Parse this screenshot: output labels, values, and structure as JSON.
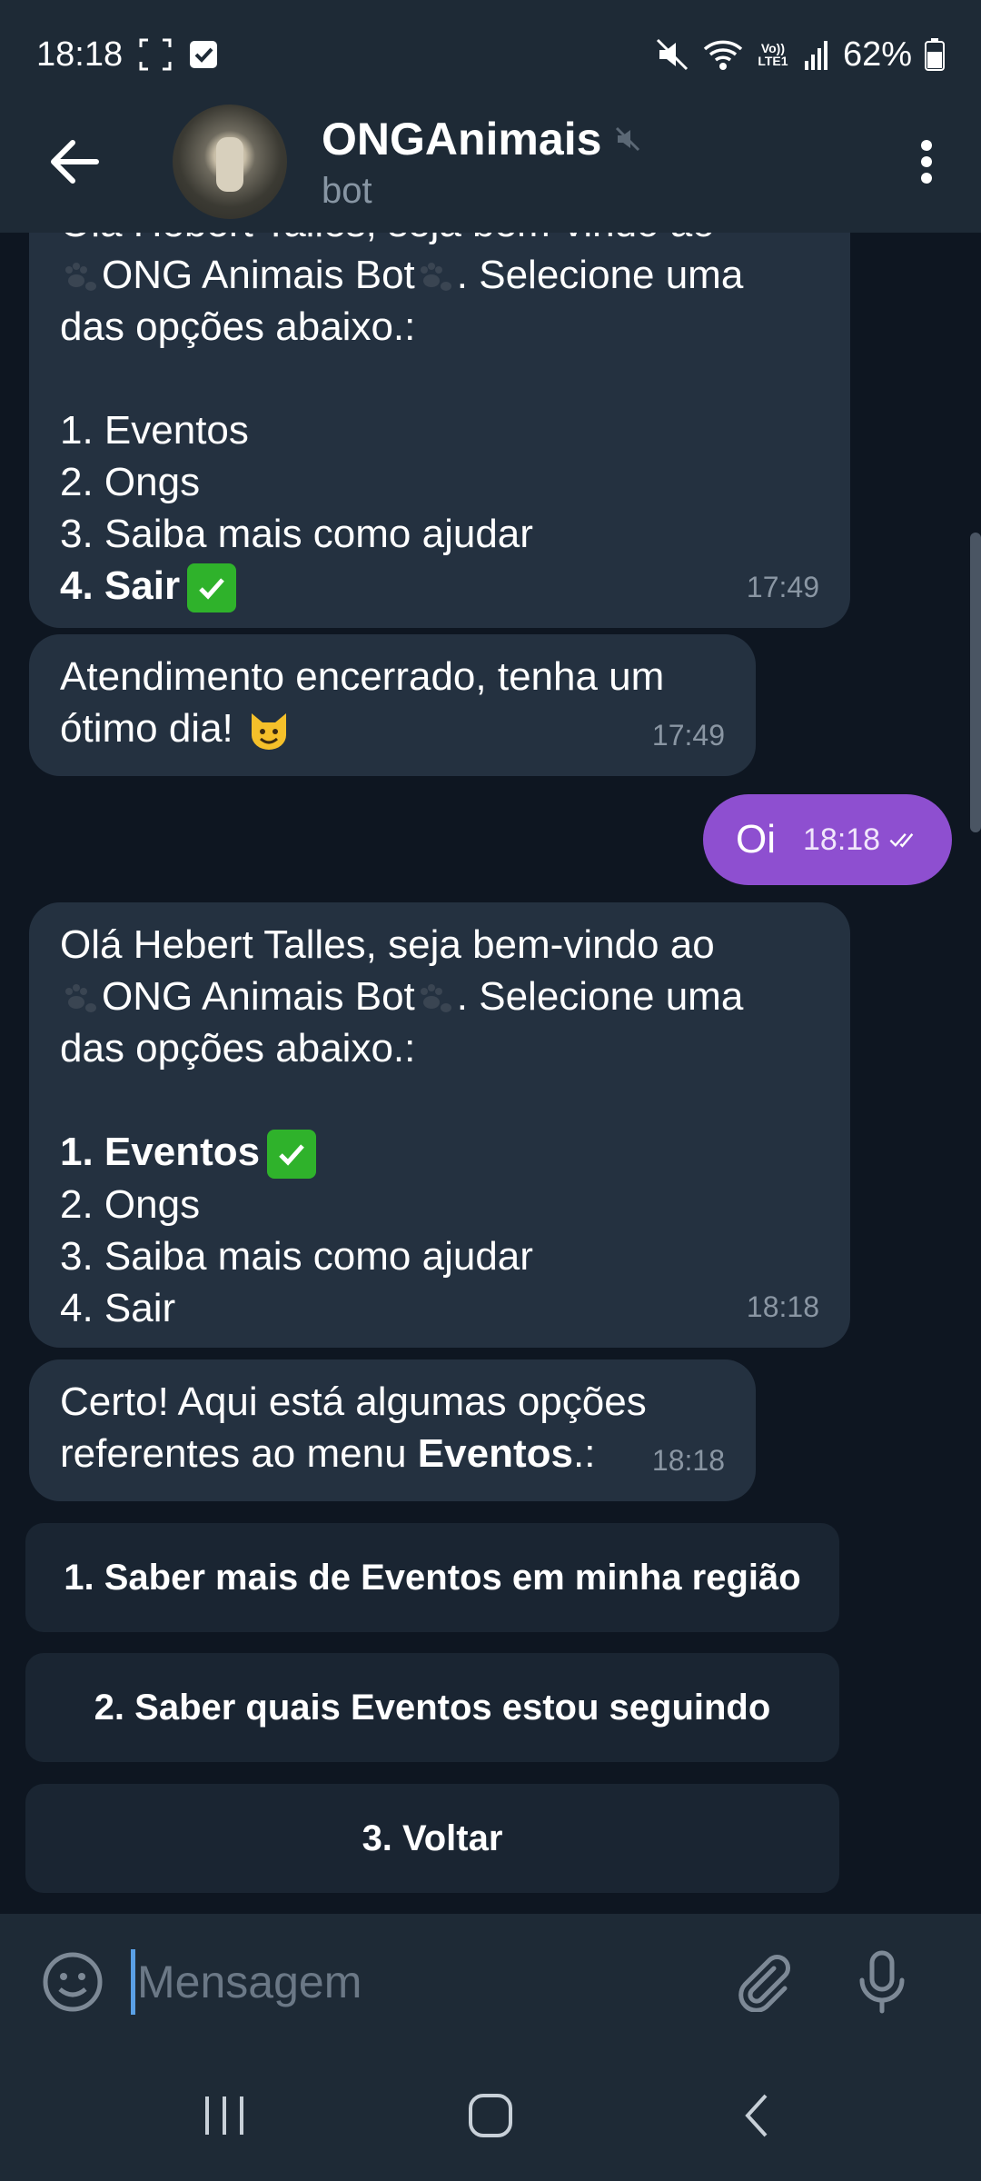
{
  "status_bar": {
    "time": "18:18",
    "battery": "62%",
    "volte": "Vo))\nLTE1"
  },
  "header": {
    "title": "ONGAnimais",
    "subtitle": "bot"
  },
  "messages": [
    {
      "id": "m1",
      "direction": "in",
      "lines": [
        "Olá Hebert Talles, seja bem-vindo ao",
        "ONG Animais Bot",
        ". Selecione uma",
        "das opções abaixo.:",
        "",
        "1. Eventos",
        "2. Ongs",
        "3. Saiba mais como ajudar",
        "4. Sair"
      ],
      "time": "17:49"
    },
    {
      "id": "m2",
      "direction": "in",
      "lines": [
        "Atendimento encerrado, tenha um",
        "ótimo dia!"
      ],
      "time": "17:49"
    },
    {
      "id": "m3",
      "direction": "out",
      "text": "Oi",
      "time": "18:18"
    },
    {
      "id": "m4",
      "direction": "in",
      "lines": [
        "Olá Hebert Talles, seja bem-vindo ao",
        "ONG Animais Bot",
        ". Selecione uma",
        "das opções abaixo.:",
        "",
        "1. Eventos",
        "2. Ongs",
        "3. Saiba mais como ajudar",
        "4. Sair"
      ],
      "time": "18:18"
    },
    {
      "id": "m5",
      "direction": "in",
      "lines": [
        "Certo! Aqui está algumas opções",
        "referentes ao menu ",
        "Eventos",
        ".:"
      ],
      "time": "18:18"
    }
  ],
  "keyboard_buttons": [
    "1. Saber mais de Eventos em minha região",
    "2. Saber quais Eventos estou seguindo",
    "3. Voltar"
  ],
  "input": {
    "placeholder": "Mensagem"
  },
  "colors": {
    "header_bg": "#1e2a36",
    "chat_bg": "#0e1621",
    "incoming_bubble": "#243140",
    "outgoing_bubble": "#8e4fd0",
    "timestamp": "#8a96a3"
  },
  "icons": {
    "back": "arrow-left-icon",
    "muted": "muted-speaker-icon",
    "menu": "kebab-menu-icon",
    "emoji": "smiley-icon",
    "attach": "paperclip-icon",
    "mic": "microphone-icon",
    "read_receipt": "double-check-icon",
    "check_emoji": "check-mark-emoji",
    "cat_emoji": "smiling-cat-emoji",
    "paw": "paw-prints-icon"
  }
}
